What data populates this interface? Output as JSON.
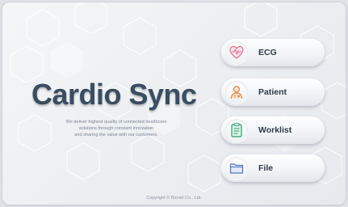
{
  "app": {
    "title": "Cardio Sync",
    "tagline": [
      "We deliver highest quality of connected healthcare",
      "solutions through constant innovation",
      "and sharing the value with our customers."
    ],
    "copyright": "Copyright © Bionet Co., Ltd."
  },
  "menu": {
    "ecg": {
      "label": "ECG",
      "icon": "heart-ecg-icon"
    },
    "patient": {
      "label": "Patient",
      "icon": "patient-icon"
    },
    "worklist": {
      "label": "Worklist",
      "icon": "clipboard-icon"
    },
    "file": {
      "label": "File",
      "icon": "folder-icon"
    }
  },
  "colors": {
    "title": "#3a4d62",
    "ecg_icon": "#e86a8a",
    "patient_icon": "#e8823a",
    "worklist_icon": "#2e9e6e",
    "file_icon": "#4a78c8"
  }
}
